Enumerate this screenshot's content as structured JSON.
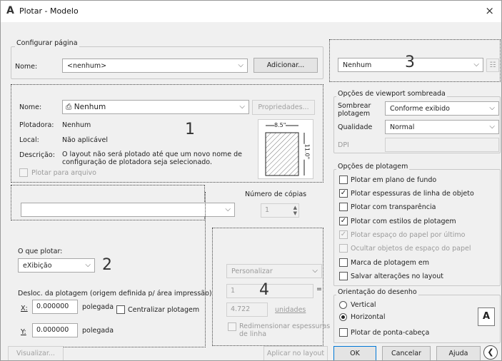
{
  "window": {
    "title": "Plotar - Modelo",
    "close": "×"
  },
  "page_setup": {
    "group_title": "Configurar página",
    "name_label": "Nome:",
    "name_value": "<nenhum>",
    "add_button": "Adicionar..."
  },
  "plotter": {
    "name_label": "Nome:",
    "name_value": "Nenhum",
    "properties_button": "Propriedades...",
    "plotter_label": "Plotadora:",
    "plotter_value": "Nenhum",
    "location_label": "Local:",
    "location_value": "Não aplicável",
    "description_label": "Descrição:",
    "description_value_line1": "O layout não será plotado até que um novo nome de",
    "description_value_line2": "configuração de plotadora seja selecionado.",
    "plot_to_file": "Plotar para arquivo",
    "preview_width": "8.5\"",
    "preview_height": "11.0\""
  },
  "paper_size": {
    "value": ""
  },
  "copies": {
    "label": "Número de cópias",
    "value": "1"
  },
  "plot_area": {
    "what_label": "O que plotar:",
    "what_value": "eXibição"
  },
  "plot_offset": {
    "title": "Desloc. da plotagem (origem definida p/ área impressão)",
    "x_label": "X:",
    "x_value": "0.000000",
    "x_unit": "polegada",
    "center_label": "Centralizar plotagem",
    "y_label": "Y:",
    "y_value": "0.000000",
    "y_unit": "polegada"
  },
  "plot_scale": {
    "scale_value": "Personalizar",
    "scale_line1": "1",
    "scale_line2": "4.722",
    "units_label": "unidades",
    "lineweights_line1": "Redimensionar espessuras",
    "lineweights_line2": "de linha"
  },
  "style_table": {
    "value": "Nenhum"
  },
  "shaded_viewport": {
    "title": "Opções de viewport sombreada",
    "shade_label_line1": "Sombrear",
    "shade_label_line2": "plotagem",
    "shade_value": "Conforme exibido",
    "quality_label": "Qualidade",
    "quality_value": "Normal",
    "dpi_label": "DPI",
    "dpi_value": ""
  },
  "plot_options": {
    "title": "Opções de plotagem",
    "items": [
      "Plotar em plano de fundo",
      "Plotar espessuras de linha de objeto",
      "Plotar com transparência",
      "Plotar com estilos de plotagem",
      "Plotar espaço do papel por último",
      "Ocultar objetos de espaço do papel",
      "Marca de plotagem em",
      "Salvar alterações no layout"
    ]
  },
  "orientation": {
    "title": "Orientação do desenho",
    "portrait": "Vertical",
    "landscape": "Horizontal",
    "upside_down": "Plotar de ponta-cabeça"
  },
  "footer": {
    "preview_button": "Visualizar...",
    "apply_button": "Aplicar no layout",
    "ok_button": "OK",
    "cancel_button": "Cancelar",
    "help_button": "Ajuda"
  },
  "callouts": {
    "one": "1",
    "two": "2",
    "three": "3",
    "four": "4"
  }
}
